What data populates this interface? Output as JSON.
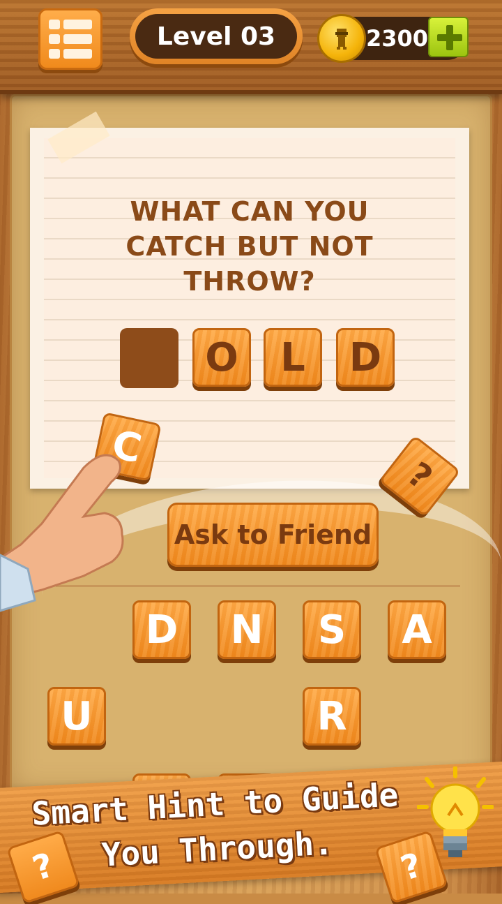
{
  "header": {
    "level_label": "Level 03",
    "coins": "2300"
  },
  "puzzle": {
    "question_lines": [
      "WHAT CAN YOU",
      "CATCH BUT NOT",
      "THROW?"
    ],
    "answer_letters": [
      "",
      "O",
      "L",
      "D"
    ],
    "dragged_letter": "C",
    "hint_tile_symbol": "?"
  },
  "hint_button": {
    "label": "Ask to Friend"
  },
  "letter_pool": [
    "D",
    "N",
    "S",
    "A",
    "U",
    "R"
  ],
  "promo": {
    "line1": "Smart Hint to Guide",
    "line2": "You Through.",
    "question_mark": "?"
  },
  "colors": {
    "tile_orange": "#f08a1e",
    "tile_text_brown": "#7a3a10",
    "plus_green": "#9cc410",
    "coin_gold": "#f5b40a"
  }
}
